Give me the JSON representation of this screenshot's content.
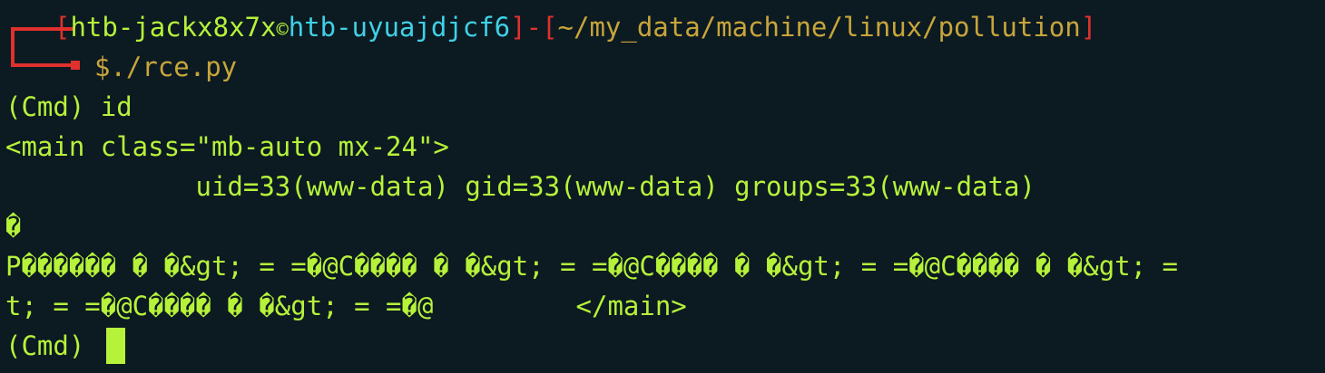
{
  "prompt": {
    "bracket_left": "[",
    "user": "htb-jackx8x7x",
    "at_symbol": "©",
    "host": "htb-uyuajdjcf6",
    "bracket_right": "]",
    "separator": "-",
    "path_open": "[",
    "path": "~/my_data/machine/linux/pollution",
    "path_close": "]",
    "command_prefix": "$",
    "command": "./rce.py"
  },
  "output": {
    "line3": "(Cmd) id",
    "line4": "<main class=\"mb-auto mx-24\">",
    "line5": "            uid=33(www-data) gid=33(www-data) groups=33(www-data)",
    "line6": "�",
    "line7": "P������ � �&gt; = =�@C���� � �&gt; = =�@C���� � �&gt; = =�@C���� � �&gt; =",
    "line8": "t; = =�@C���� � �&gt; = =�@         </main>",
    "line9": "(Cmd) "
  },
  "colors": {
    "background": "#0c1a22",
    "text_green": "#b6f23a",
    "accent_red": "#e0312c",
    "host_cyan": "#3fd1e6",
    "path_gold": "#c8a53a"
  }
}
